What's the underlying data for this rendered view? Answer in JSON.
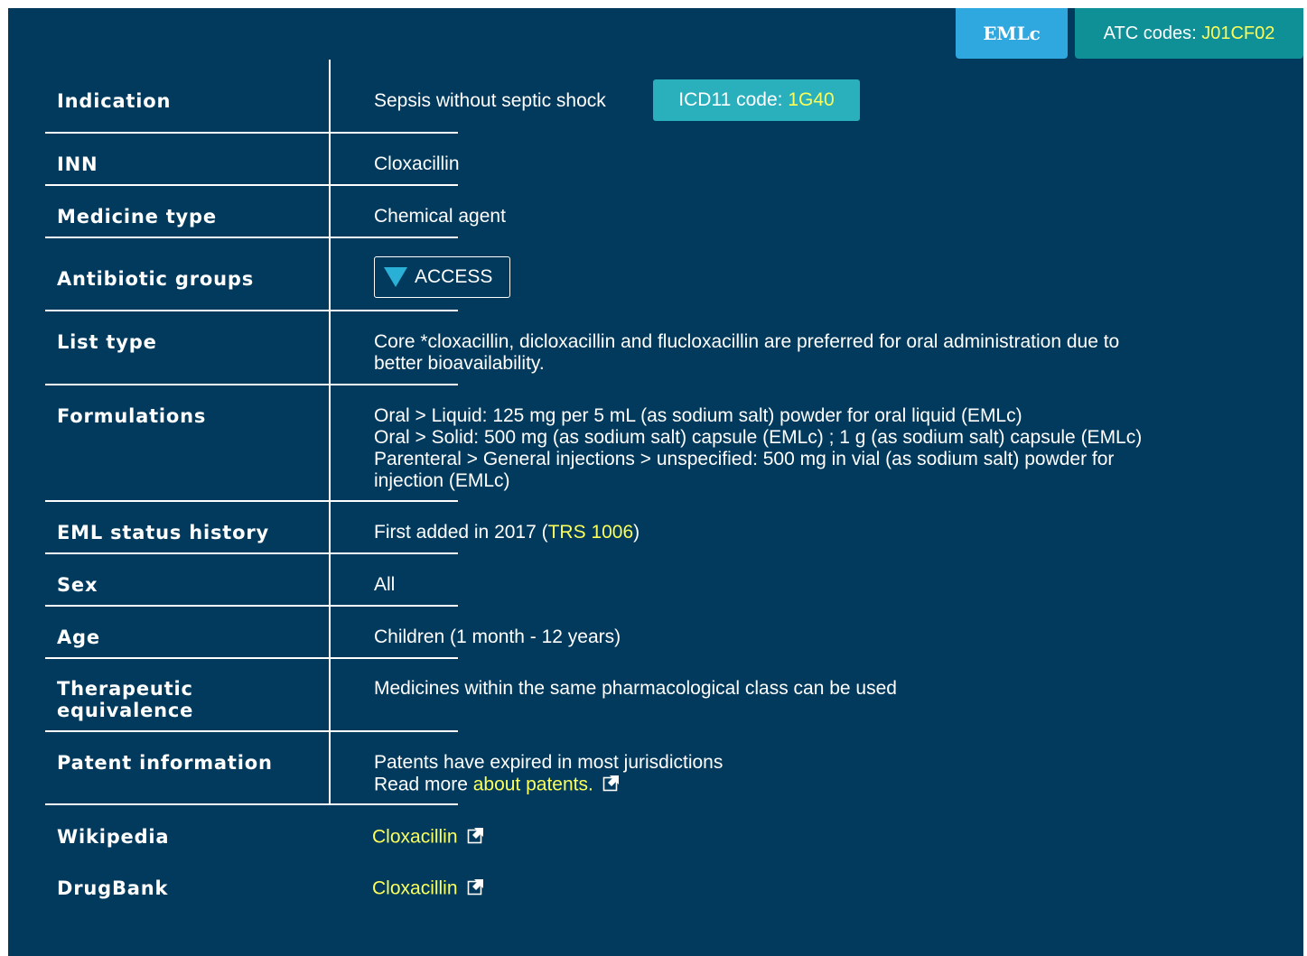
{
  "header": {
    "emlc_label": "EMLc",
    "atc_prefix": "ATC codes: ",
    "atc_code": "J01CF02"
  },
  "rows": {
    "indication": {
      "label": "Indication",
      "value": "Sepsis without septic shock",
      "icd_prefix": "ICD11 code: ",
      "icd_code": "1G40"
    },
    "inn": {
      "label": "INN",
      "value": "Cloxacillin"
    },
    "medicine_type": {
      "label": "Medicine type",
      "value": "Chemical agent"
    },
    "antibiotic_groups": {
      "label": "Antibiotic groups",
      "badge": "ACCESS",
      "badge_color": "#2ab0d6"
    },
    "list_type": {
      "label": "List type",
      "line1": "Core *cloxacillin, dicloxacillin and flucloxacillin are preferred for oral administration due to",
      "line2": "better bioavailability."
    },
    "formulations": {
      "label": "Formulations",
      "lines": [
        "Oral > Liquid: 125 mg per 5 mL (as sodium salt) powder for oral liquid (EMLc)",
        "Oral > Solid: 500 mg (as sodium salt) capsule (EMLc) ; 1 g (as sodium salt) capsule (EMLc)",
        "Parenteral > General injections > unspecified: 500 mg in vial (as sodium salt) powder for",
        "injection (EMLc)"
      ]
    },
    "eml_status_history": {
      "label": "EML status history",
      "prefix": "First added in 2017 (",
      "link": "TRS 1006",
      "suffix": ")"
    },
    "sex": {
      "label": "Sex",
      "value": "All"
    },
    "age": {
      "label": "Age",
      "value": "Children (1 month - 12 years)"
    },
    "therapeutic_equivalence": {
      "label_line1": "Therapeutic",
      "label_line2": "equivalence",
      "value": "Medicines within the same pharmacological class can be used"
    },
    "patent_information": {
      "label": "Patent information",
      "line1": "Patents have expired in most jurisdictions",
      "line2_prefix": "Read more ",
      "link": "about patents.",
      "icon": "external-link-icon"
    },
    "wikipedia": {
      "label": "Wikipedia",
      "link": "Cloxacillin",
      "icon": "external-link-icon"
    },
    "drugbank": {
      "label": "DrugBank",
      "link": "Cloxacillin",
      "icon": "external-link-icon"
    }
  },
  "colors": {
    "panel_bg": "#013a5c",
    "emlc_bg": "#2fa7df",
    "atc_bg": "#0f8f96",
    "icd_bg": "#2ab0bd",
    "link": "#fcff5a"
  }
}
